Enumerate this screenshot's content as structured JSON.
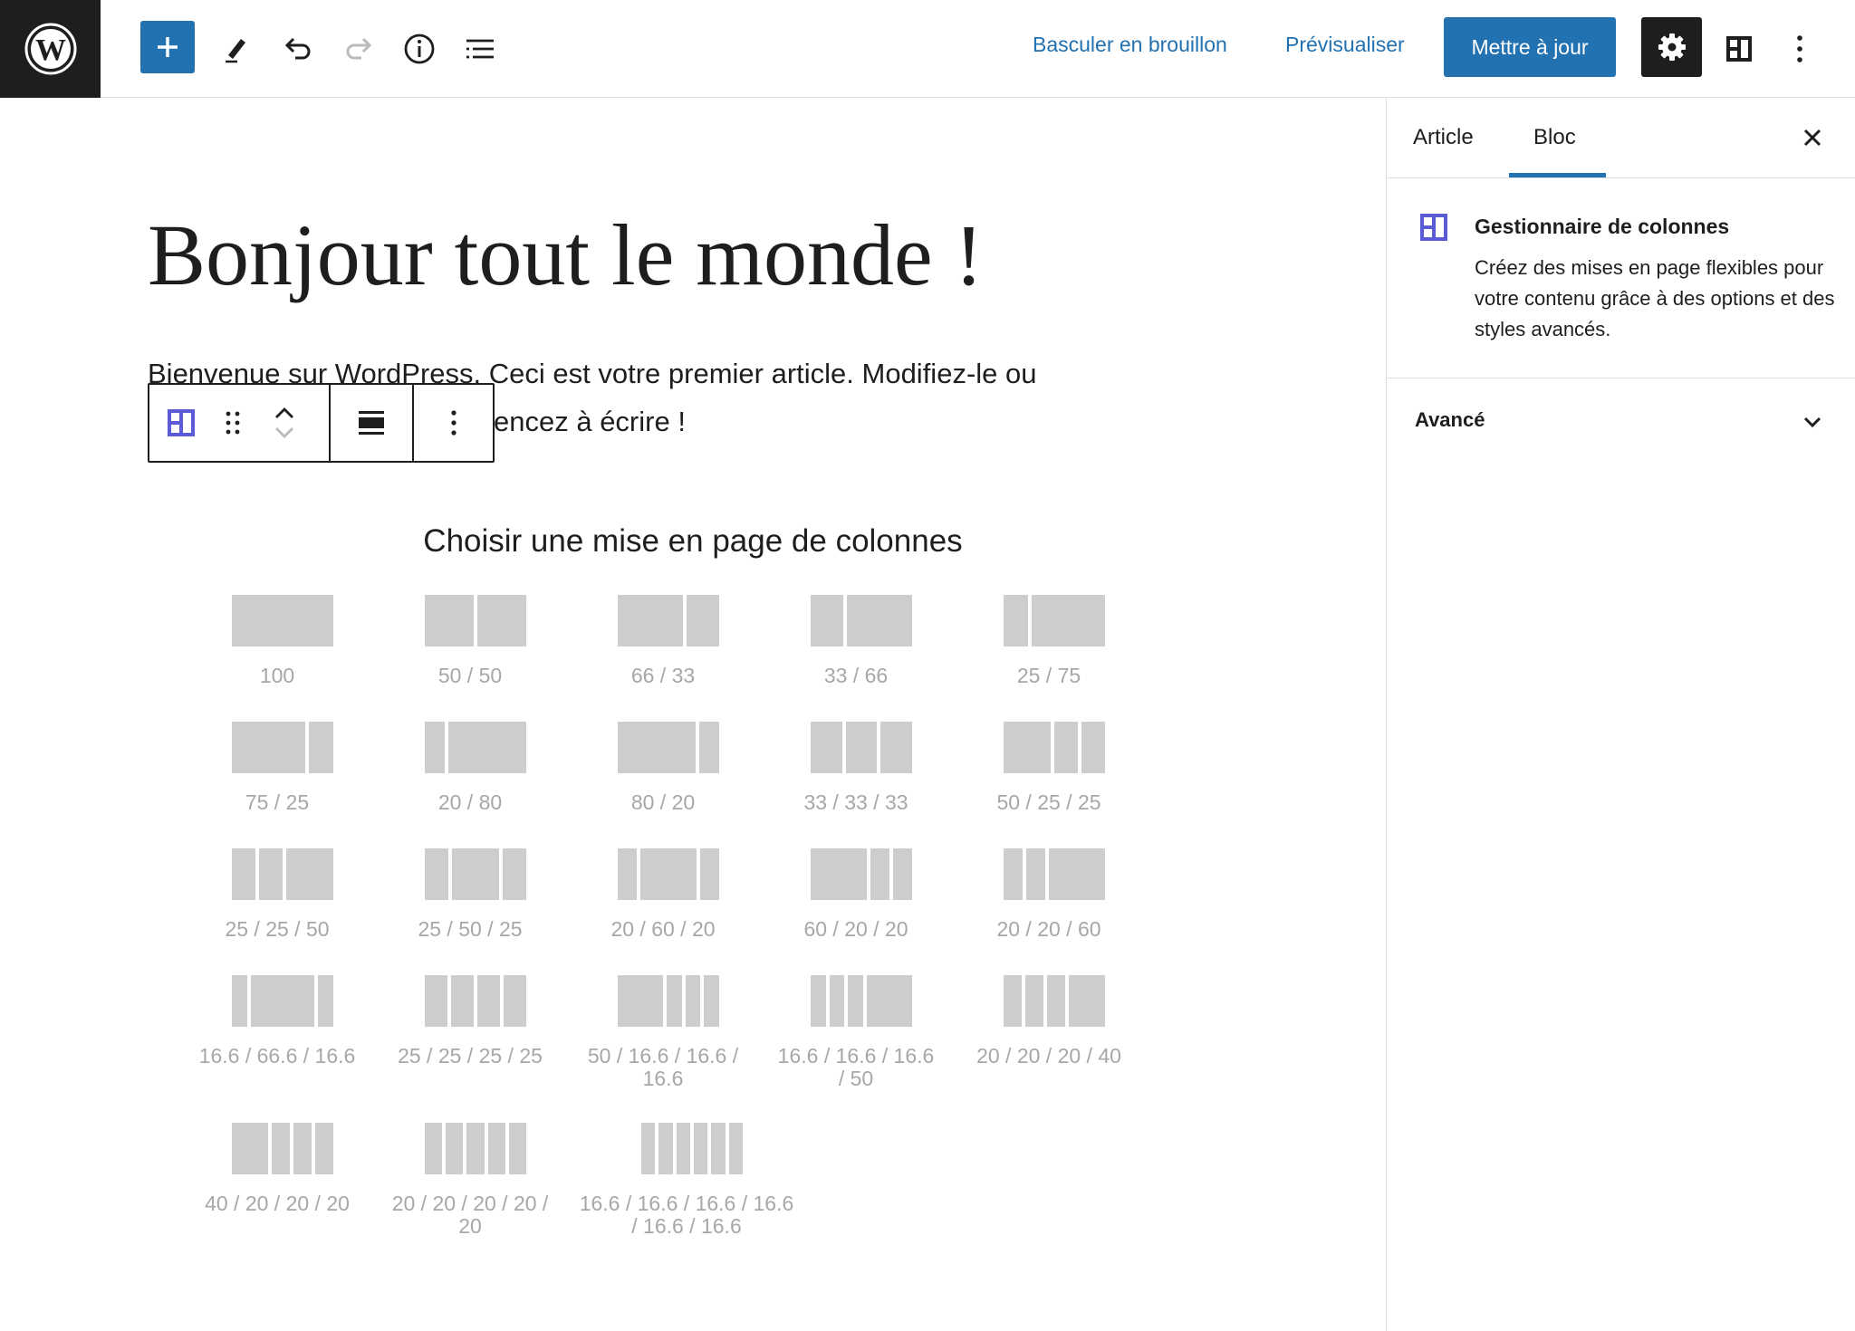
{
  "topbar": {
    "wp_logo": "wordpress-logo",
    "add_icon": "plus-icon",
    "tools": [
      {
        "name": "edit-pencil-icon"
      },
      {
        "name": "undo-icon"
      },
      {
        "name": "redo-icon"
      },
      {
        "name": "info-icon"
      },
      {
        "name": "list-view-icon"
      }
    ],
    "draft_label": "Basculer en brouillon",
    "preview_label": "Prévisualiser",
    "update_label": "Mettre à jour",
    "settings_icon": "gear-icon",
    "plugin_icon": "columns-layout-icon",
    "more_icon": "more-vertical-icon",
    "accent_color": "#2271b1"
  },
  "editor": {
    "post_title": "Bonjour tout le monde !",
    "paragraph_link": "Bienvenue sur WordPress",
    "paragraph_rest": ". Ceci est votre premier article. Modifiez-le ou",
    "paragraph_line2": "encez à écrire !",
    "block_toolbar": {
      "block_icon": "columns-block-icon",
      "drag_icon": "drag-handle-icon",
      "move_up_icon": "chevron-up-icon",
      "move_down_icon": "chevron-down-icon",
      "align_icon": "align-full-icon",
      "options_icon": "more-vertical-icon"
    },
    "layouts_title": "Choisir une mise en page de colonnes",
    "layouts": [
      {
        "label": "100",
        "cols": [
          100
        ]
      },
      {
        "label": "50 / 50",
        "cols": [
          50,
          50
        ]
      },
      {
        "label": "66 / 33",
        "cols": [
          66,
          33
        ]
      },
      {
        "label": "33 / 66",
        "cols": [
          33,
          66
        ]
      },
      {
        "label": "25 / 75",
        "cols": [
          25,
          75
        ]
      },
      {
        "label": "75 / 25",
        "cols": [
          75,
          25
        ]
      },
      {
        "label": "20 / 80",
        "cols": [
          20,
          80
        ]
      },
      {
        "label": "80 / 20",
        "cols": [
          80,
          20
        ]
      },
      {
        "label": "33 / 33 / 33",
        "cols": [
          33,
          33,
          33
        ]
      },
      {
        "label": "50 / 25 / 25",
        "cols": [
          50,
          25,
          25
        ]
      },
      {
        "label": "25 / 25 / 50",
        "cols": [
          25,
          25,
          50
        ]
      },
      {
        "label": "25 / 50 / 25",
        "cols": [
          25,
          50,
          25
        ]
      },
      {
        "label": "20 / 60 / 20",
        "cols": [
          20,
          60,
          20
        ]
      },
      {
        "label": "60 / 20 / 20",
        "cols": [
          60,
          20,
          20
        ]
      },
      {
        "label": "20 / 20 / 60",
        "cols": [
          20,
          20,
          60
        ]
      },
      {
        "label": "16.6 / 66.6 / 16.6",
        "cols": [
          16.6,
          66.6,
          16.6
        ]
      },
      {
        "label": "25 / 25 / 25 / 25",
        "cols": [
          25,
          25,
          25,
          25
        ]
      },
      {
        "label": "50 / 16.6 / 16.6 / 16.6",
        "cols": [
          50,
          16.6,
          16.6,
          16.6
        ]
      },
      {
        "label": "16.6 / 16.6 / 16.6 / 50",
        "cols": [
          16.6,
          16.6,
          16.6,
          50
        ]
      },
      {
        "label": "20 / 20 / 20 / 40",
        "cols": [
          20,
          20,
          20,
          40
        ]
      },
      {
        "label": "40 / 20 / 20 / 20",
        "cols": [
          40,
          20,
          20,
          20
        ]
      },
      {
        "label": "20 / 20 / 20 / 20 / 20",
        "cols": [
          20,
          20,
          20,
          20,
          20
        ]
      },
      {
        "label": "16.6 / 16.6 / 16.6 / 16.6 / 16.6 / 16.6",
        "cols": [
          16.6,
          16.6,
          16.6,
          16.6,
          16.6,
          16.6
        ]
      }
    ]
  },
  "sidebar": {
    "tabs": [
      {
        "label": "Article"
      },
      {
        "label": "Bloc"
      }
    ],
    "active_tab": "Bloc",
    "close_icon": "close-icon",
    "block": {
      "icon": "columns-block-icon",
      "title": "Gestionnaire de colonnes",
      "description": "Créez des mises en page flexibles pour votre contenu grâce à des options et des styles avancés."
    },
    "advanced": {
      "label": "Avancé",
      "icon": "chevron-down-icon"
    }
  }
}
